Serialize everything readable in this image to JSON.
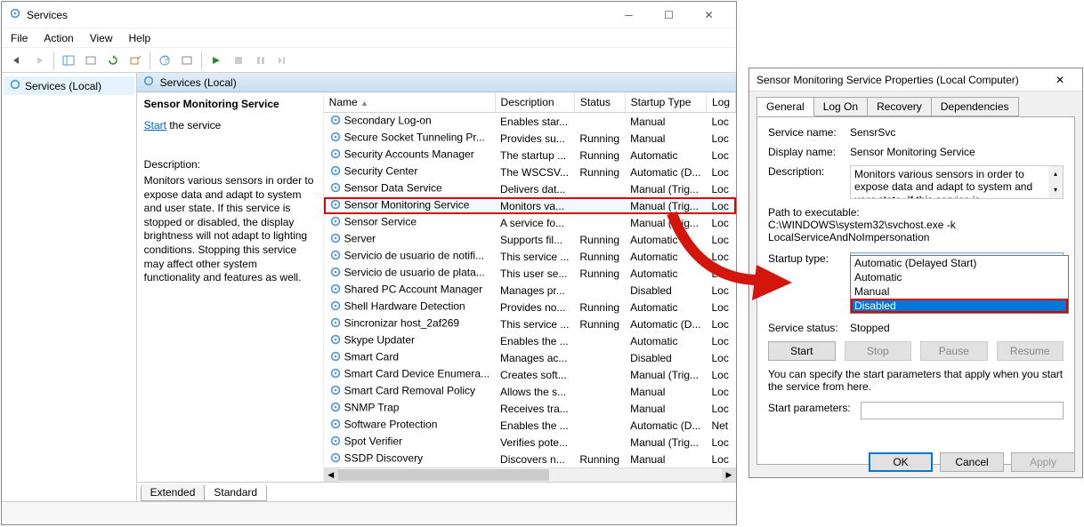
{
  "services_window": {
    "title": "Services",
    "menus": {
      "file": "File",
      "action": "Action",
      "view": "View",
      "help": "Help"
    },
    "left_pane_item": "Services (Local)",
    "pane_header": "Services (Local)",
    "detail": {
      "heading": "Sensor Monitoring Service",
      "start_link": "Start",
      "start_suffix": " the service",
      "desc_label": "Description:",
      "desc_text": "Monitors various sensors in order to expose data and adapt to system and user state.  If this service is stopped or disabled, the display brightness will not adapt to lighting conditions. Stopping this service may affect other system functionality and features as well."
    },
    "columns": {
      "name": "Name",
      "description": "Description",
      "status": "Status",
      "startup": "Startup Type",
      "logon": "Log"
    },
    "rows": [
      {
        "name": "Secondary Log-on",
        "desc": "Enables star...",
        "status": "",
        "startup": "Manual",
        "logon": "Loc"
      },
      {
        "name": "Secure Socket Tunneling Pr...",
        "desc": "Provides su...",
        "status": "Running",
        "startup": "Manual",
        "logon": "Loc"
      },
      {
        "name": "Security Accounts Manager",
        "desc": "The startup ...",
        "status": "Running",
        "startup": "Automatic",
        "logon": "Loc"
      },
      {
        "name": "Security Center",
        "desc": "The WSCSV...",
        "status": "Running",
        "startup": "Automatic (D...",
        "logon": "Loc"
      },
      {
        "name": "Sensor Data Service",
        "desc": "Delivers dat...",
        "status": "",
        "startup": "Manual (Trig...",
        "logon": "Loc"
      },
      {
        "name": "Sensor Monitoring Service",
        "desc": "Monitors va...",
        "status": "",
        "startup": "Manual (Trig...",
        "logon": "Loc",
        "selected": true
      },
      {
        "name": "Sensor Service",
        "desc": "A service fo...",
        "status": "",
        "startup": "Manual (Trig...",
        "logon": "Loc"
      },
      {
        "name": "Server",
        "desc": "Supports fil...",
        "status": "Running",
        "startup": "Automatic",
        "logon": "Loc"
      },
      {
        "name": "Servicio de usuario de notifi...",
        "desc": "This service ...",
        "status": "Running",
        "startup": "Automatic",
        "logon": "Loc"
      },
      {
        "name": "Servicio de usuario de plata...",
        "desc": "This user se...",
        "status": "Running",
        "startup": "Automatic",
        "logon": "Loc"
      },
      {
        "name": "Shared PC Account Manager",
        "desc": "Manages pr...",
        "status": "",
        "startup": "Disabled",
        "logon": "Loc"
      },
      {
        "name": "Shell Hardware Detection",
        "desc": "Provides no...",
        "status": "Running",
        "startup": "Automatic",
        "logon": "Loc"
      },
      {
        "name": "Sincronizar host_2af269",
        "desc": "This service ...",
        "status": "Running",
        "startup": "Automatic (D...",
        "logon": "Loc"
      },
      {
        "name": "Skype Updater",
        "desc": "Enables the ...",
        "status": "",
        "startup": "Automatic",
        "logon": "Loc"
      },
      {
        "name": "Smart Card",
        "desc": "Manages ac...",
        "status": "",
        "startup": "Disabled",
        "logon": "Loc"
      },
      {
        "name": "Smart Card Device Enumera...",
        "desc": "Creates soft...",
        "status": "",
        "startup": "Manual (Trig...",
        "logon": "Loc"
      },
      {
        "name": "Smart Card Removal Policy",
        "desc": "Allows the s...",
        "status": "",
        "startup": "Manual",
        "logon": "Loc"
      },
      {
        "name": "SNMP Trap",
        "desc": "Receives tra...",
        "status": "",
        "startup": "Manual",
        "logon": "Loc"
      },
      {
        "name": "Software Protection",
        "desc": "Enables the ...",
        "status": "",
        "startup": "Automatic (D...",
        "logon": "Net"
      },
      {
        "name": "Spot Verifier",
        "desc": "Verifies pote...",
        "status": "",
        "startup": "Manual (Trig...",
        "logon": "Loc"
      },
      {
        "name": "SSDP Discovery",
        "desc": "Discovers n...",
        "status": "Running",
        "startup": "Manual",
        "logon": "Loc"
      }
    ],
    "tabs": {
      "extended": "Extended",
      "standard": "Standard"
    }
  },
  "properties_dialog": {
    "title": "Sensor Monitoring Service Properties (Local Computer)",
    "tabs": {
      "general": "General",
      "logon": "Log On",
      "recovery": "Recovery",
      "deps": "Dependencies"
    },
    "labels": {
      "service_name": "Service name:",
      "display_name": "Display name:",
      "description": "Description:",
      "path": "Path to executable:",
      "startup": "Startup type:",
      "status": "Service status:",
      "params": "Start parameters:",
      "help": "You can specify the start parameters that apply when you start the service from here."
    },
    "values": {
      "service_name": "SensrSvc",
      "display_name": "Sensor Monitoring Service",
      "description": "Monitors various sensors in order to expose data and adapt to system and user state.  If this service is",
      "path": "C:\\WINDOWS\\system32\\svchost.exe -k LocalServiceAndNoImpersonation",
      "startup_selected": "Manual",
      "status": "Stopped"
    },
    "dropdown_options": [
      "Automatic (Delayed Start)",
      "Automatic",
      "Manual",
      "Disabled"
    ],
    "dropdown_highlight_index": 3,
    "buttons": {
      "start": "Start",
      "stop": "Stop",
      "pause": "Pause",
      "resume": "Resume",
      "ok": "OK",
      "cancel": "Cancel",
      "apply": "Apply"
    }
  }
}
